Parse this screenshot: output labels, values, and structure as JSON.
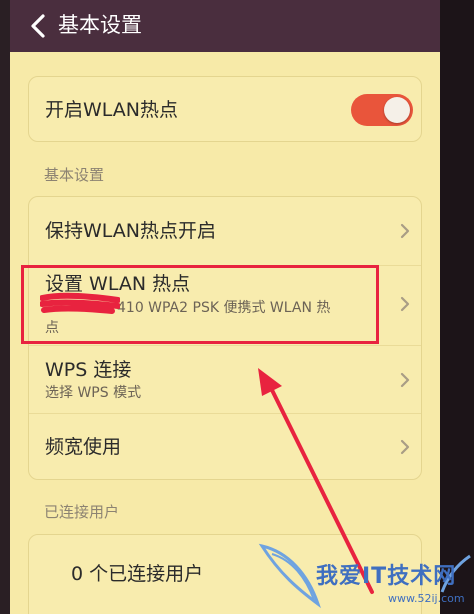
{
  "header": {
    "title": "基本设置"
  },
  "wlan_hotspot": {
    "label": "开启WLAN热点",
    "enabled": true
  },
  "sections": {
    "basic_settings_label": "基本设置",
    "connected_users_label": "已连接用户"
  },
  "settings_items": [
    {
      "title": "保持WLAN热点开启"
    },
    {
      "title": "设置 WLAN 热点",
      "subtitle_line1": "410 WPA2 PSK 便携式 WLAN 热",
      "subtitle_line2": "点"
    },
    {
      "title": "WPS 连接",
      "subtitle": "选择 WPS 模式"
    },
    {
      "title": "频宽使用"
    }
  ],
  "connected_users": {
    "text": "0 个已连接用户"
  },
  "watermark": {
    "brand": "我爱IT技术网",
    "url": "www.52ij.com"
  },
  "colors": {
    "header_bg": "#4a2e3e",
    "screen_bg": "#f7eaa8",
    "toggle_on": "#e9553b",
    "annotation_red": "#e8233f"
  }
}
